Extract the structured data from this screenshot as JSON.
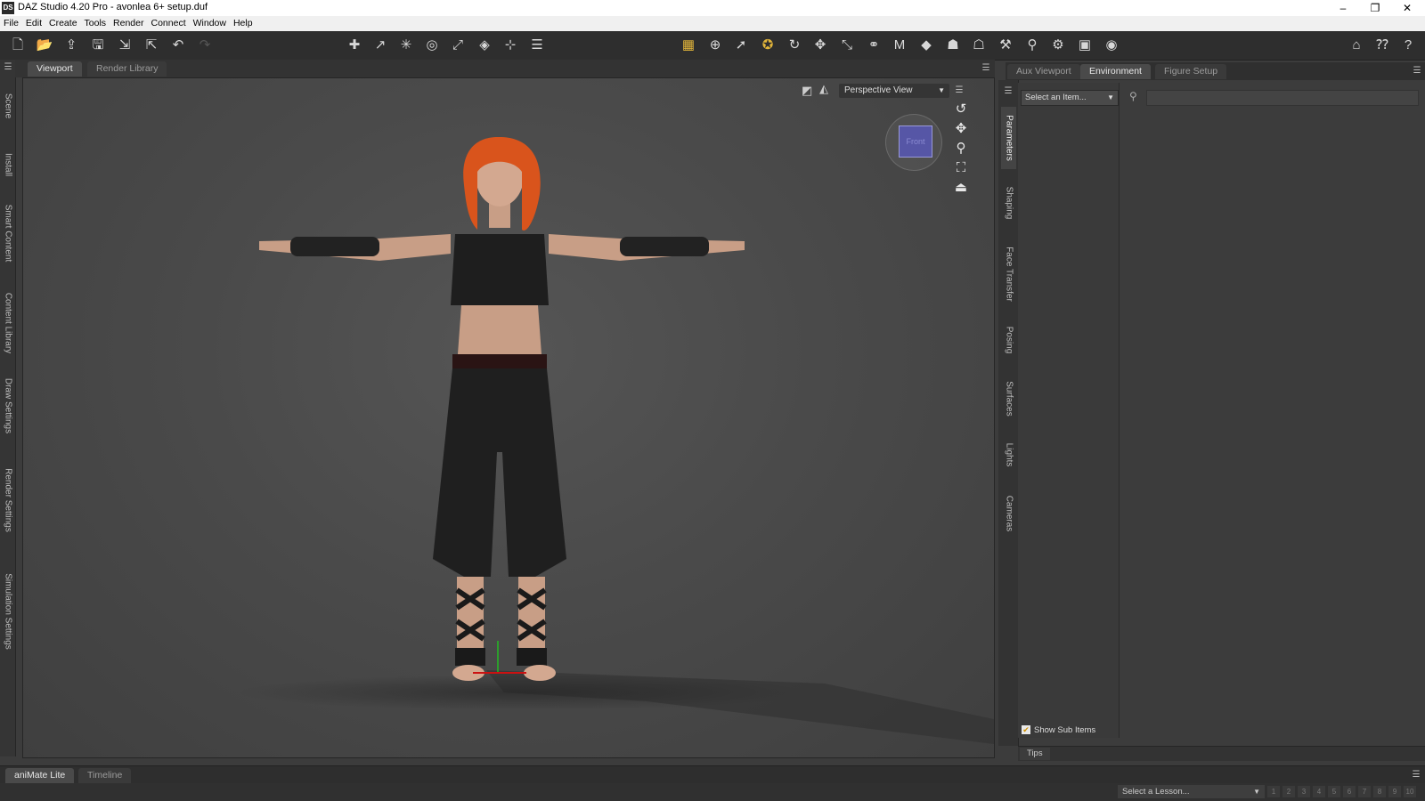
{
  "window": {
    "app_icon": "DS",
    "title": "DAZ Studio 4.20 Pro - avonlea 6+ setup.duf",
    "minimize": "–",
    "restore": "❐",
    "close": "✕"
  },
  "menu": [
    "File",
    "Edit",
    "Create",
    "Tools",
    "Render",
    "Connect",
    "Window",
    "Help"
  ],
  "toolbar": {
    "icons": [
      "new-file-icon",
      "open-file-icon",
      "merge-icon",
      "save-icon",
      "import-icon",
      "export-icon",
      "undo-icon",
      "redo-icon",
      "new-figure-icon",
      "new-spotlight-icon",
      "new-light-icon",
      "new-point-light-icon",
      "new-camera-icon",
      "new-primitive-icon",
      "new-null-icon",
      "align-icon",
      "node-select-icon",
      "universal-tool-icon",
      "pointer-icon",
      "rotate-tool-icon",
      "rotate-icon",
      "translate-icon",
      "scale-icon",
      "joint-editor-icon",
      "morph-tool-icon",
      "geometry-tool-icon",
      "surface-tool-icon",
      "figure-icon",
      "render-settings-icon",
      "select-tool-icon",
      "pose-tool-icon",
      "render-icon",
      "camera-icon",
      "home-icon",
      "whats-this-icon",
      "help-icon"
    ]
  },
  "left_tabs": [
    "Scene",
    "Install",
    "Smart Content",
    "Content Library",
    "Draw Settings",
    "Render Settings",
    "Simulation Settings"
  ],
  "viewport": {
    "tabs": [
      "Viewport",
      "Render Library"
    ],
    "active_tab": "Viewport",
    "view_mode": "Perspective View",
    "cube_label": "Front"
  },
  "right_panel": {
    "tabs": [
      "Aux Viewport",
      "Environment",
      "Figure Setup"
    ],
    "active_tab": "Environment",
    "vertical_tabs": [
      "Parameters",
      "Shaping",
      "Face Transfer",
      "Posing",
      "Surfaces",
      "Lights",
      "Cameras"
    ],
    "active_vertical_tab": "Parameters",
    "select_item": "Select an Item...",
    "show_sub_items": "Show Sub Items",
    "show_sub_items_checked": true,
    "tips_tab": "Tips"
  },
  "bottom": {
    "tabs": [
      "aniMate Lite",
      "Timeline"
    ],
    "active_tab": "aniMate Lite",
    "lesson_select": "Select a Lesson...",
    "lesson_steps": [
      "1",
      "2",
      "3",
      "4",
      "5",
      "6",
      "7",
      "8",
      "9",
      "10"
    ]
  },
  "colors": {
    "background": "#3c3c3c",
    "accent": "#e2b53a",
    "figure_hair": "#d9541c",
    "nav_cube": "#5656a6"
  }
}
